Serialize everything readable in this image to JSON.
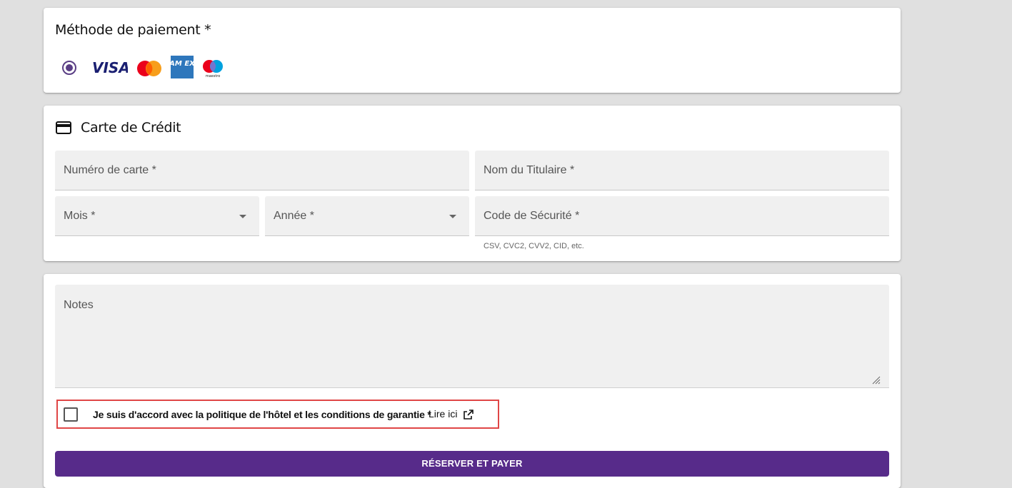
{
  "payment_method": {
    "title": "Méthode de paiement *",
    "cards": [
      "visa-logo",
      "mastercard-logo",
      "amex-logo",
      "maestro-logo"
    ],
    "visa_text": "VISA",
    "amex_text": "AM EX",
    "maestro_text": "maestro",
    "selected": true
  },
  "credit_card": {
    "title": "Carte de Crédit",
    "icon": "credit-card-icon",
    "fields": {
      "number": "Numéro de carte *",
      "holder": "Nom du Titulaire *",
      "month": "Mois *",
      "year": "Année *",
      "cvc": "Code de Sécurité *"
    },
    "cvc_hint": "CSV, CVC2, CVV2, CID, etc."
  },
  "notes": {
    "label": "Notes"
  },
  "agreement": {
    "text": "Je suis d'accord avec la politique de l'hôtel et les conditions de garantie *",
    "link_label": "Lire ici",
    "checked": false
  },
  "submit": {
    "label": "RÉSERVER ET PAYER"
  },
  "colors": {
    "accent": "#572b8a",
    "highlight_border": "#e04646",
    "field_bg": "#f0f0f0",
    "page_bg": "#e0e0e0"
  }
}
